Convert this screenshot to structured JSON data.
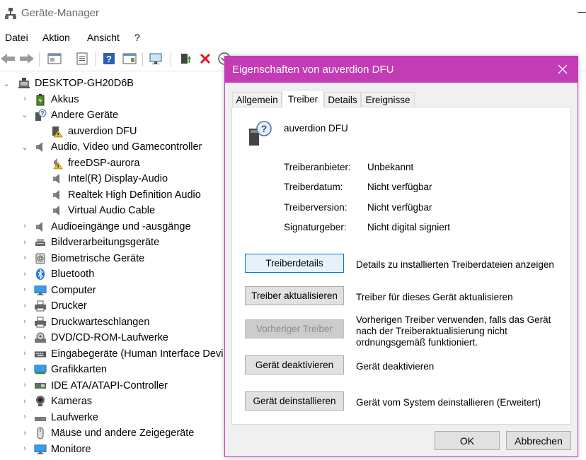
{
  "window": {
    "title": "Geräte-Manager"
  },
  "menu": {
    "items": [
      "Datei",
      "Aktion",
      "Ansicht",
      "?"
    ]
  },
  "tree": {
    "root": "DESKTOP-GH20D6B",
    "items": [
      {
        "label": "Akkus"
      },
      {
        "label": "Andere Geräte"
      },
      {
        "label": "auverdion DFU"
      },
      {
        "label": "Audio, Video und Gamecontroller"
      },
      {
        "label": "freeDSP-aurora"
      },
      {
        "label": "Intel(R) Display-Audio"
      },
      {
        "label": "Realtek High Definition Audio"
      },
      {
        "label": "Virtual Audio Cable"
      },
      {
        "label": "Audioeingänge und -ausgänge"
      },
      {
        "label": "Bildverarbeitungsgeräte"
      },
      {
        "label": "Biometrische Geräte"
      },
      {
        "label": "Bluetooth"
      },
      {
        "label": "Computer"
      },
      {
        "label": "Drucker"
      },
      {
        "label": "Druckwarteschlangen"
      },
      {
        "label": "DVD/CD-ROM-Laufwerke"
      },
      {
        "label": "Eingabegeräte (Human Interface Devi"
      },
      {
        "label": "Grafikkarten"
      },
      {
        "label": "IDE ATA/ATAPI-Controller"
      },
      {
        "label": "Kameras"
      },
      {
        "label": "Laufwerke"
      },
      {
        "label": "Mäuse und andere Zeigegeräte"
      },
      {
        "label": "Monitore"
      }
    ]
  },
  "dialog": {
    "title": "Eigenschaften von auverdion DFU",
    "tabs": [
      "Allgemein",
      "Treiber",
      "Details",
      "Ereignisse"
    ],
    "device_name": "auverdion DFU",
    "properties": [
      {
        "label": "Treiberanbieter:",
        "value": "Unbekannt"
      },
      {
        "label": "Treiberdatum:",
        "value": "Nicht verfügbar"
      },
      {
        "label": "Treiberversion:",
        "value": "Nicht verfügbar"
      },
      {
        "label": "Signaturgeber:",
        "value": "Nicht digital signiert"
      }
    ],
    "actions": [
      {
        "button": "Treiberdetails",
        "description": "Details zu installierten Treiberdateien anzeigen"
      },
      {
        "button": "Treiber aktualisieren",
        "description": "Treiber für dieses Gerät aktualisieren"
      },
      {
        "button": "Vorheriger Treiber",
        "description": "Vorherigen Treiber verwenden, falls das Gerät nach der Treiberaktualisierung nicht ordnungsgemäß funktioniert."
      },
      {
        "button": "Gerät deaktivieren",
        "description": "Gerät deaktivieren"
      },
      {
        "button": "Gerät deinstallieren",
        "description": "Gerät vom System deinstallieren (Erweitert)"
      }
    ],
    "ok_label": "OK",
    "cancel_label": "Abbrechen"
  },
  "colors": {
    "accent": "#c33cb5",
    "focus": "#0078d7"
  }
}
